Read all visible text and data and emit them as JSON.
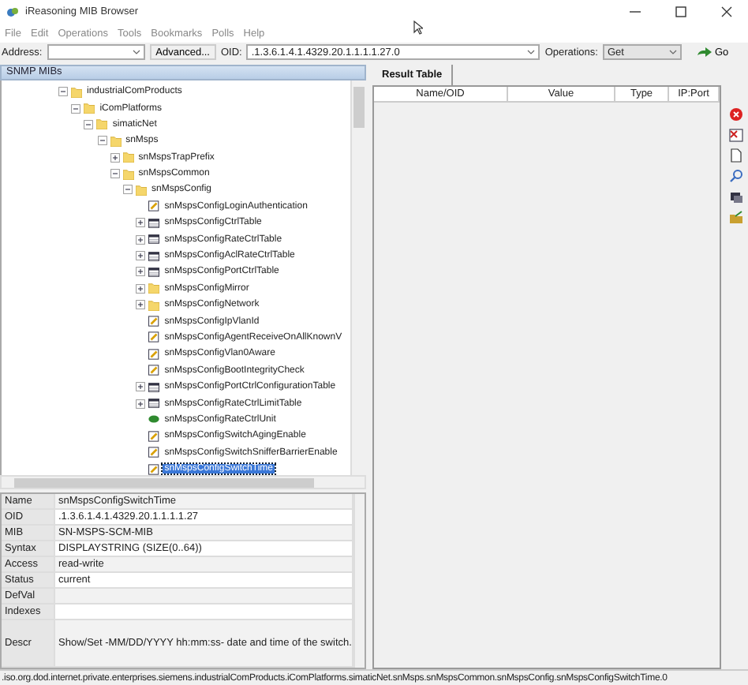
{
  "window": {
    "title": "iReasoning MIB Browser"
  },
  "menu": [
    "File",
    "Edit",
    "Operations",
    "Tools",
    "Bookmarks",
    "Polls",
    "Help"
  ],
  "toolbar": {
    "address_label": "Address:",
    "advanced_button": "Advanced...",
    "oid_label": "OID:",
    "oid_value": ".1.3.6.1.4.1.4329.20.1.1.1.1.27.0",
    "operations_label": "Operations:",
    "operation_value": "Get",
    "go_button": "Go"
  },
  "mib_tree": {
    "title": "SNMP MIBs",
    "nodes": [
      {
        "label": "industrialComProducts",
        "kind": "folder",
        "expanded": true,
        "selected": false,
        "children": [
          {
            "label": "iComPlatforms",
            "kind": "folder",
            "expanded": true,
            "selected": false,
            "children": [
              {
                "label": "simaticNet",
                "kind": "folder",
                "expanded": true,
                "selected": false,
                "children": [
                  {
                    "label": "snMsps",
                    "kind": "folder",
                    "expanded": true,
                    "selected": false,
                    "children": [
                      {
                        "label": "snMspsTrapPrefix",
                        "kind": "folder",
                        "expanded": false,
                        "selected": false
                      },
                      {
                        "label": "snMspsCommon",
                        "kind": "folder",
                        "expanded": true,
                        "selected": false,
                        "children": [
                          {
                            "label": "snMspsConfig",
                            "kind": "folder",
                            "expanded": true,
                            "selected": false,
                            "children": [
                              {
                                "label": "snMspsConfigLoginAuthentication",
                                "kind": "scalar",
                                "selected": false
                              },
                              {
                                "label": "snMspsConfigCtrlTable",
                                "kind": "table",
                                "expanded": false,
                                "selected": false
                              },
                              {
                                "label": "snMspsConfigRateCtrlTable",
                                "kind": "table",
                                "expanded": false,
                                "selected": false
                              },
                              {
                                "label": "snMspsConfigAclRateCtrlTable",
                                "kind": "table",
                                "expanded": false,
                                "selected": false
                              },
                              {
                                "label": "snMspsConfigPortCtrlTable",
                                "kind": "table",
                                "expanded": false,
                                "selected": false
                              },
                              {
                                "label": "snMspsConfigMirror",
                                "kind": "folder",
                                "expanded": false,
                                "selected": false
                              },
                              {
                                "label": "snMspsConfigNetwork",
                                "kind": "folder",
                                "expanded": false,
                                "selected": false
                              },
                              {
                                "label": "snMspsConfigIpVlanId",
                                "kind": "scalar",
                                "selected": false
                              },
                              {
                                "label": "snMspsConfigAgentReceiveOnAllKnownV",
                                "kind": "scalar",
                                "selected": false
                              },
                              {
                                "label": "snMspsConfigVlan0Aware",
                                "kind": "scalar",
                                "selected": false
                              },
                              {
                                "label": "snMspsConfigBootIntegrityCheck",
                                "kind": "scalar",
                                "selected": false
                              },
                              {
                                "label": "snMspsConfigPortCtrlConfigurationTable",
                                "kind": "table",
                                "expanded": false,
                                "selected": false
                              },
                              {
                                "label": "snMspsConfigRateCtrlLimitTable",
                                "kind": "table",
                                "expanded": false,
                                "selected": false
                              },
                              {
                                "label": "snMspsConfigRateCtrlUnit",
                                "kind": "type",
                                "selected": false
                              },
                              {
                                "label": "snMspsConfigSwitchAgingEnable",
                                "kind": "scalar",
                                "selected": false
                              },
                              {
                                "label": "snMspsConfigSwitchSnifferBarrierEnable",
                                "kind": "scalar",
                                "selected": false
                              },
                              {
                                "label": "snMspsConfigSwitchTime",
                                "kind": "scalar",
                                "selected": true
                              }
                            ]
                          }
                        ]
                      }
                    ]
                  }
                ]
              }
            ]
          }
        ]
      }
    ]
  },
  "properties": [
    {
      "label": "Name",
      "value": "snMspsConfigSwitchTime"
    },
    {
      "label": "OID",
      "value": ".1.3.6.1.4.1.4329.20.1.1.1.1.27"
    },
    {
      "label": "MIB",
      "value": "SN-MSPS-SCM-MIB"
    },
    {
      "label": "Syntax",
      "value": "DISPLAYSTRING (SIZE(0..64))"
    },
    {
      "label": "Access",
      "value": "read-write"
    },
    {
      "label": "Status",
      "value": "current"
    },
    {
      "label": "DefVal"
    },
    {
      "label": "Indexes"
    },
    {
      "label": "Descr",
      "value": "Show/Set -MM/DD/YYYY hh:mm:ss- date and time of the switch.",
      "kind": "tall"
    }
  ],
  "tabs": [
    {
      "label": "Result Table",
      "selected": true
    }
  ],
  "result_table": {
    "columns": [
      "Name/OID",
      "Value",
      "Type",
      "IP:Port"
    ]
  },
  "status_bar": ".iso.org.dod.internet.private.enterprises.siemens.industrialComProducts.iComPlatforms.simaticNet.snMsps.snMspsCommon.snMspsConfig.snMspsConfigSwitchTime.0"
}
